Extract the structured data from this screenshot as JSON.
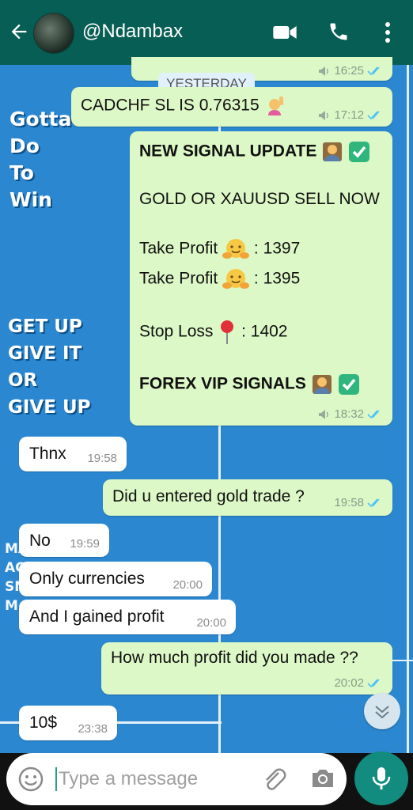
{
  "header": {
    "title": "@Ndambax",
    "icons": [
      "back-arrow-icon",
      "contact-avatar",
      "video-call-icon",
      "phone-icon",
      "more-options-icon"
    ]
  },
  "wallpaper": {
    "text1": [
      "Gotta",
      "Do",
      "To",
      "Win"
    ],
    "text2": [
      "GET UP",
      "GIVE IT",
      "OR",
      "GIVE UP"
    ],
    "text3": [
      "MASSIVE",
      "AC",
      "SM",
      "M"
    ]
  },
  "date_chip": "YESTERDAY",
  "messages": [
    {
      "id": "m0",
      "type": "out",
      "time": "16:25"
    },
    {
      "id": "m1",
      "type": "out",
      "text": "CADCHF SL IS 0.76315",
      "time": "17:12",
      "emoji": "raising-hand"
    },
    {
      "id": "m2",
      "type": "out",
      "time": "18:32",
      "lines": {
        "l1": "NEW SIGNAL UPDATE",
        "l2": "GOLD OR XAUUSD SELL NOW",
        "l3a": "Take Profit",
        "l3b": ": 1397",
        "l4a": "Take Profit",
        "l4b": ": 1395",
        "l5a": "Stop Loss",
        "l5b": ": 1402",
        "l6": "FOREX VIP SIGNALS"
      }
    },
    {
      "id": "m3",
      "type": "in",
      "text": "Thnx",
      "time": "19:58"
    },
    {
      "id": "m4",
      "type": "out",
      "text": "Did u entered gold trade ?",
      "time": "19:58"
    },
    {
      "id": "m5",
      "type": "in",
      "text": "No",
      "time": "19:59"
    },
    {
      "id": "m6",
      "type": "in",
      "text": "Only currencies",
      "time": "20:00"
    },
    {
      "id": "m7",
      "type": "in",
      "text": "And I gained profit",
      "time": "20:00"
    },
    {
      "id": "m8",
      "type": "out",
      "text": "How much profit did you made ??",
      "time": "20:02"
    },
    {
      "id": "m9",
      "type": "in",
      "text": "10$",
      "time": "23:38"
    }
  ],
  "input": {
    "placeholder": "Type a message"
  },
  "colors": {
    "header": "#075e54",
    "outgoing": "#dcf8c6",
    "incoming": "#ffffff",
    "tick_read": "#4fc3f7",
    "mic": "#128c7e"
  }
}
